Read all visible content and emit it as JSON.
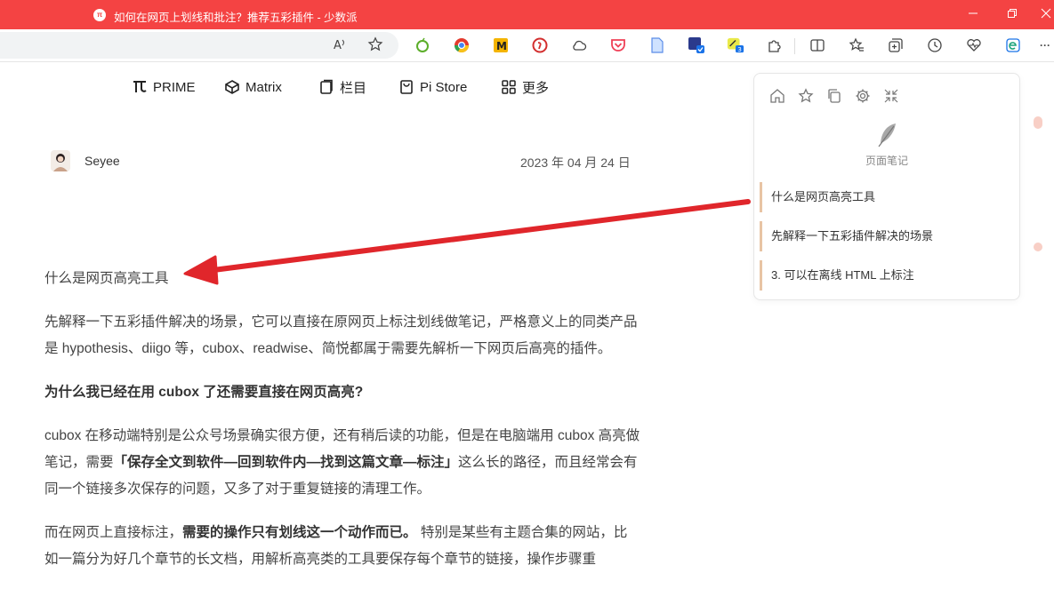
{
  "window": {
    "title": "如何在网页上划线和批注？推荐五彩插件 - 少数派",
    "favicon_text": "π",
    "minimize_icon": "minimize-icon",
    "restore_icon": "restore-icon",
    "close_icon": "close-icon"
  },
  "toolbar": {
    "read_aloud_label": "A",
    "extension_badge": "3",
    "more_label": "···"
  },
  "nav": {
    "items": [
      {
        "label": "PRIME",
        "icon": "prime-icon"
      },
      {
        "label": "Matrix",
        "icon": "matrix-icon"
      },
      {
        "label": "栏目",
        "icon": "column-icon"
      },
      {
        "label": "Pi Store",
        "icon": "store-icon"
      },
      {
        "label": "更多",
        "icon": "more-grid-icon"
      }
    ]
  },
  "author": {
    "name": "Seyee",
    "date": "2023 年 04 月 24 日"
  },
  "article": {
    "heading": "什么是网页高亮工具",
    "p1": "先解释一下五彩插件解决的场景，它可以直接在原网页上标注划线做笔记，严格意义上的同类产品是 hypothesis、diigo 等，cubox、readwise、简悦都属于需要先解析一下网页后高亮的插件。",
    "subheading": "为什么我已经在用 cubox 了还需要直接在网页高亮?",
    "p2_a": "cubox 在移动端特别是公众号场景确实很方便，还有稍后读的功能，但是在电脑端用 cubox 高亮做笔记，需要",
    "p2_bold": "「保存全文到软件—回到软件内—找到这篇文章—标注」",
    "p2_b": "这么长的路径，而且经常会有同一个链接多次保存的问题，又多了对于重复链接的清理工作。",
    "p3_a": "而在网页上直接标注，",
    "p3_bold": "需要的操作只有划线这一个动作而已。",
    "p3_b": " 特别是某些有主题合集的网站，比如一篇分为好几个章节的长文档，用解析高亮类的工具要保存每个章节的链接，操作步骤重"
  },
  "notes_panel": {
    "title": "页面笔记",
    "items": [
      "什么是网页高亮工具",
      "先解释一下五彩插件解决的场景",
      "3. 可以在离线 HTML 上标注"
    ]
  },
  "colors": {
    "titlebar": "#f44343",
    "annotation_arrow": "#e0262b",
    "highlight_bar": "#e8c4a4"
  }
}
